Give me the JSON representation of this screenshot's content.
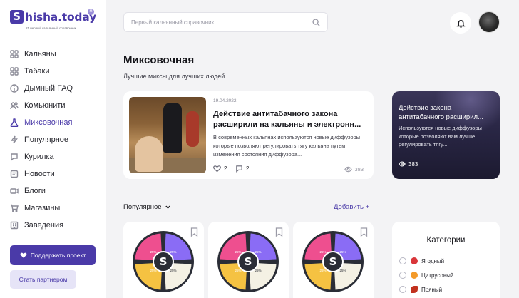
{
  "brand": {
    "name": "hisha.today",
    "tagline": "#1 первый кальянный справочник",
    "badge": "R",
    "accent": "#4a3aa8"
  },
  "sidebar": {
    "items": [
      {
        "label": "Кальяны",
        "icon": "grid-icon"
      },
      {
        "label": "Табаки",
        "icon": "grid-icon"
      },
      {
        "label": "Дымный FAQ",
        "icon": "info-icon"
      },
      {
        "label": "Комьюнити",
        "icon": "users-icon"
      },
      {
        "label": "Миксовочная",
        "icon": "flask-icon",
        "active": true
      },
      {
        "label": "Популярное",
        "icon": "lightning-icon"
      },
      {
        "label": "Курилка",
        "icon": "chat-icon"
      },
      {
        "label": "Новости",
        "icon": "news-icon"
      },
      {
        "label": "Блоги",
        "icon": "video-icon"
      },
      {
        "label": "Магазины",
        "icon": "cart-icon"
      },
      {
        "label": "Заведения",
        "icon": "building-icon"
      }
    ],
    "support_label": "Поддержать проект",
    "partner_label": "Стать партнером"
  },
  "search": {
    "placeholder": "Первый кальянный справочник"
  },
  "main": {
    "title": "Миксовочная",
    "subtitle": "Лучшие миксы для лучших людей",
    "featured": {
      "date": "19.04.2022",
      "title": "Действие антитабачного закона расширили на кальяны и электронн...",
      "excerpt": "В современных кальянах используются новые диффузоры которые позволяют регулировать тягу кальяна путем изменения состояния диффузора...",
      "likes": "2",
      "comments": "2",
      "views": "383"
    },
    "side_article": {
      "title": "Действие закона антитабачного расширил...",
      "excerpt": "Используются новые диффузоры которые позволяют вам лучше регулировать тягу...",
      "views": "383"
    },
    "sort_label": "Популярное",
    "add_label": "Добавить +",
    "mixes": [
      {
        "segments": [
          "25%",
          "25%",
          "25%",
          "25%"
        ],
        "logo": "S"
      },
      {
        "segments": [
          "25%",
          "25%",
          "25%",
          "25%"
        ],
        "logo": "S"
      },
      {
        "segments": [
          "25%",
          "25%",
          "25%",
          "25%"
        ],
        "logo": "S"
      }
    ],
    "segment_colors": [
      "#ee4f8f",
      "#8a6cf5",
      "#f5c242",
      "#f4f1e4"
    ]
  },
  "categories": {
    "title": "Категории",
    "items": [
      {
        "label": "Ягодный",
        "color": "#d9363a"
      },
      {
        "label": "Цитрусовый",
        "color": "#f39a2a"
      },
      {
        "label": "Пряный",
        "color": "#c2311e"
      }
    ]
  }
}
